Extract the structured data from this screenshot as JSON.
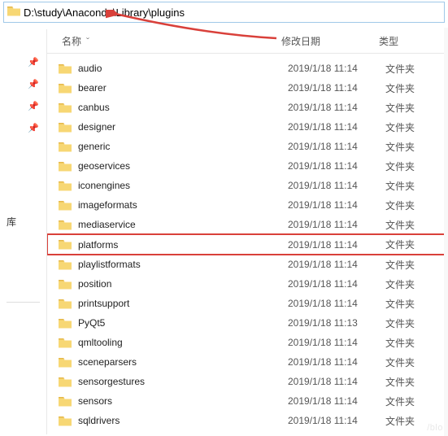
{
  "address": {
    "path": "D:\\study\\Anaconda\\Library\\plugins"
  },
  "sidebar": {
    "library_label": "库"
  },
  "columns": {
    "name": "名称",
    "date": "修改日期",
    "type": "类型"
  },
  "type_label": "文件夹",
  "highlighted_index": 9,
  "folders": [
    {
      "name": "audio",
      "date": "2019/1/18 11:14"
    },
    {
      "name": "bearer",
      "date": "2019/1/18 11:14"
    },
    {
      "name": "canbus",
      "date": "2019/1/18 11:14"
    },
    {
      "name": "designer",
      "date": "2019/1/18 11:14"
    },
    {
      "name": "generic",
      "date": "2019/1/18 11:14"
    },
    {
      "name": "geoservices",
      "date": "2019/1/18 11:14"
    },
    {
      "name": "iconengines",
      "date": "2019/1/18 11:14"
    },
    {
      "name": "imageformats",
      "date": "2019/1/18 11:14"
    },
    {
      "name": "mediaservice",
      "date": "2019/1/18 11:14"
    },
    {
      "name": "platforms",
      "date": "2019/1/18 11:14"
    },
    {
      "name": "playlistformats",
      "date": "2019/1/18 11:14"
    },
    {
      "name": "position",
      "date": "2019/1/18 11:14"
    },
    {
      "name": "printsupport",
      "date": "2019/1/18 11:14"
    },
    {
      "name": "PyQt5",
      "date": "2019/1/18 11:13"
    },
    {
      "name": "qmltooling",
      "date": "2019/1/18 11:14"
    },
    {
      "name": "sceneparsers",
      "date": "2019/1/18 11:14"
    },
    {
      "name": "sensorgestures",
      "date": "2019/1/18 11:14"
    },
    {
      "name": "sensors",
      "date": "2019/1/18 11:14"
    },
    {
      "name": "sqldrivers",
      "date": "2019/1/18 11:14"
    }
  ],
  "watermark": "/blo"
}
